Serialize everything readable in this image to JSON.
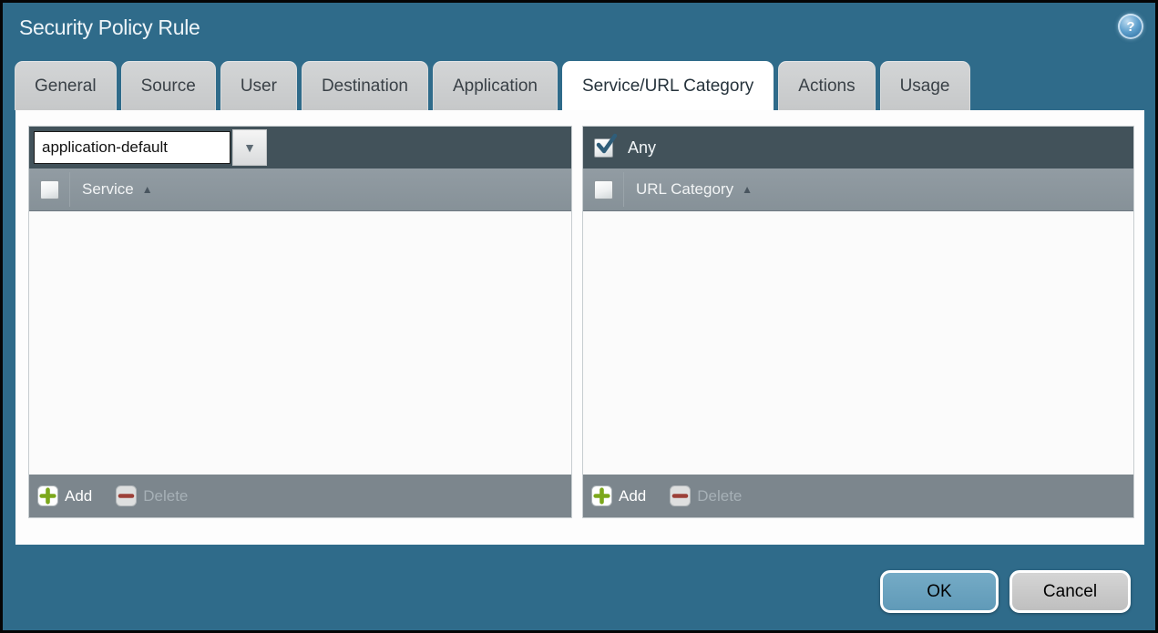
{
  "window": {
    "title": "Security Policy Rule"
  },
  "tabs": [
    {
      "label": "General",
      "active": false
    },
    {
      "label": "Source",
      "active": false
    },
    {
      "label": "User",
      "active": false
    },
    {
      "label": "Destination",
      "active": false
    },
    {
      "label": "Application",
      "active": false
    },
    {
      "label": "Service/URL Category",
      "active": true
    },
    {
      "label": "Actions",
      "active": false
    },
    {
      "label": "Usage",
      "active": false
    }
  ],
  "service_panel": {
    "mode_value": "application-default",
    "column_header": "Service",
    "rows": [],
    "add_label": "Add",
    "delete_label": "Delete",
    "delete_enabled": false
  },
  "url_category_panel": {
    "any_label": "Any",
    "any_checked": true,
    "column_header": "URL Category",
    "rows": [],
    "add_label": "Add",
    "delete_label": "Delete",
    "delete_enabled": false
  },
  "dialog_buttons": {
    "ok": "OK",
    "cancel": "Cancel"
  },
  "colors": {
    "background_teal": "#2F6B8A",
    "panel_header_dark": "#42525A",
    "column_header_gray": "#8A949B",
    "footer_gray": "#7C868D",
    "ok_button_blue": "#69A2C0",
    "add_plus_green": "#7CA81C",
    "delete_minus_red": "#9C4038",
    "checkmark_blue": "#2F5D79",
    "help_icon_blue": "#2C6EA0"
  }
}
